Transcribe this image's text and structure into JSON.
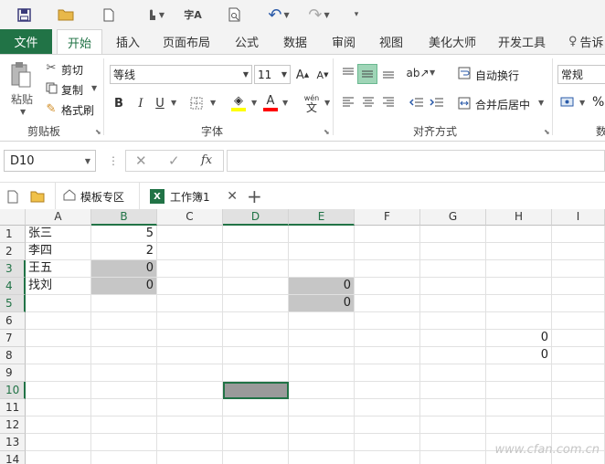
{
  "tabs": [
    "文件",
    "开始",
    "插入",
    "页面布局",
    "公式",
    "数据",
    "审阅",
    "视图",
    "美化大师",
    "开发工具",
    "告诉"
  ],
  "qat_icons": [
    "save-icon",
    "open-folder-icon",
    "new-file-icon",
    "touch-mode-icon",
    "spell-check-icon",
    "print-preview-icon",
    "undo-icon",
    "redo-icon",
    "customize-icon"
  ],
  "clipboard": {
    "paste": "粘贴",
    "cut": "剪切",
    "copy": "复制",
    "format_painter": "格式刷",
    "label": "剪贴板"
  },
  "font": {
    "name": "等线",
    "size": "11",
    "bold": "B",
    "italic": "I",
    "underline": "U",
    "wen": "wén",
    "wen_sub": "文",
    "label": "字体",
    "fill_color": "#ffff00",
    "font_color": "#ff0000"
  },
  "alignment": {
    "wrap": "自动换行",
    "merge": "合并后居中",
    "label": "对齐方式"
  },
  "number": {
    "format": "常规",
    "percent": "%",
    "label_partial": "数"
  },
  "formula_bar": {
    "name_box": "D10",
    "fx": "fx",
    "formula": ""
  },
  "doc_tabs": {
    "template": "模板专区",
    "workbook": "工作簿1"
  },
  "columns": [
    "A",
    "B",
    "C",
    "D",
    "E",
    "F",
    "G",
    "H",
    "I"
  ],
  "rows": [
    "1",
    "2",
    "3",
    "4",
    "5",
    "6",
    "7",
    "8",
    "9",
    "10",
    "11",
    "12",
    "13",
    "14"
  ],
  "cells": {
    "A1": "张三",
    "B1": "5",
    "A2": "李四",
    "B2": "2",
    "A3": "王五",
    "B3": "0",
    "A4": "找刘",
    "B4": "0",
    "E4": "0",
    "E5": "0",
    "H7": "0",
    "H8": "0"
  },
  "watermark": "www.cfan.com.cn",
  "colors": {
    "excel_green": "#217346",
    "shaded_cell": "#c6c6c6",
    "active_cell": "#9a9a9a"
  }
}
